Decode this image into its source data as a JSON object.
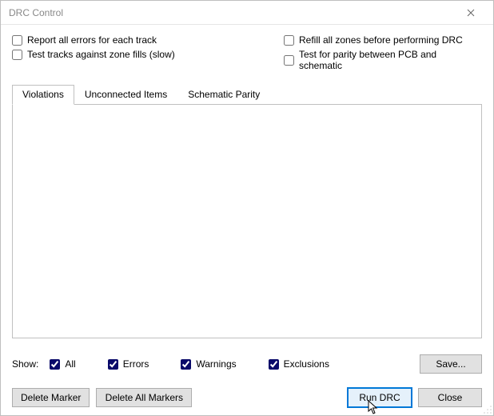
{
  "title": "DRC Control",
  "checks": {
    "report_all": "Report all errors for each track",
    "test_tracks": "Test tracks against zone fills (slow)",
    "refill": "Refill all zones before performing DRC",
    "parity": "Test for parity between PCB and schematic"
  },
  "tabs": {
    "violations": "Violations",
    "unconnected": "Unconnected Items",
    "schematic": "Schematic Parity"
  },
  "show": {
    "label": "Show:",
    "all": "All",
    "errors": "Errors",
    "warnings": "Warnings",
    "exclusions": "Exclusions"
  },
  "buttons": {
    "save": "Save...",
    "delete_marker": "Delete Marker",
    "delete_all": "Delete All Markers",
    "run": "Run DRC",
    "close": "Close"
  }
}
